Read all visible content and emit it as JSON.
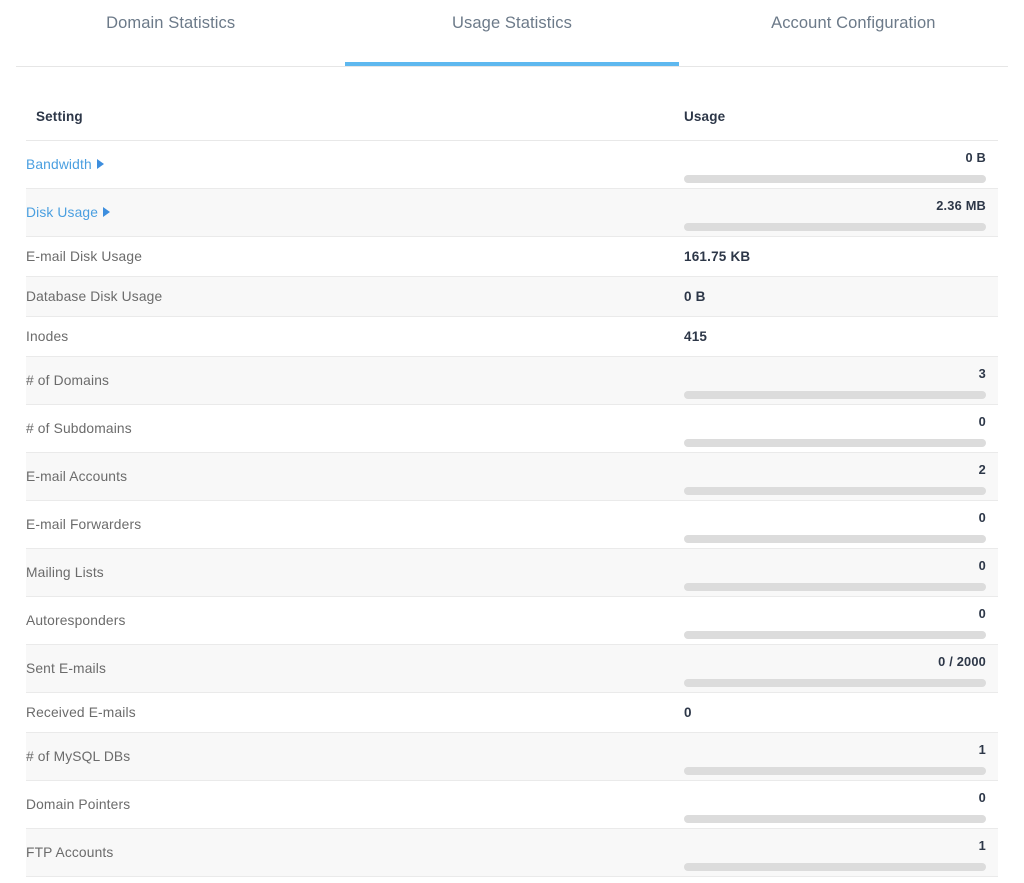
{
  "tabs": [
    {
      "label": "Domain Statistics",
      "active": false
    },
    {
      "label": "Usage Statistics",
      "active": true
    },
    {
      "label": "Account Configuration",
      "active": false
    }
  ],
  "accent_color": "#5eb8ef",
  "link_color": "#4a9fe0",
  "table": {
    "headers": {
      "setting": "Setting",
      "usage": "Usage"
    },
    "rows": [
      {
        "setting": "Bandwidth",
        "link": true,
        "caret": "triangle-right-icon",
        "usage": "0 B",
        "bar": true,
        "percent": 0
      },
      {
        "setting": "Disk Usage",
        "link": true,
        "caret": "triangle-right-icon",
        "usage": "2.36 MB",
        "bar": true,
        "percent": 0
      },
      {
        "setting": "E-mail Disk Usage",
        "link": false,
        "usage": "161.75 KB",
        "bar": false
      },
      {
        "setting": "Database Disk Usage",
        "link": false,
        "usage": "0 B",
        "bar": false
      },
      {
        "setting": "Inodes",
        "link": false,
        "usage": "415",
        "bar": false
      },
      {
        "setting": "# of Domains",
        "link": false,
        "usage": "3",
        "bar": true,
        "percent": 0
      },
      {
        "setting": "# of Subdomains",
        "link": false,
        "usage": "0",
        "bar": true,
        "percent": 0
      },
      {
        "setting": "E-mail Accounts",
        "link": false,
        "usage": "2",
        "bar": true,
        "percent": 0
      },
      {
        "setting": "E-mail Forwarders",
        "link": false,
        "usage": "0",
        "bar": true,
        "percent": 0
      },
      {
        "setting": "Mailing Lists",
        "link": false,
        "usage": "0",
        "bar": true,
        "percent": 0
      },
      {
        "setting": "Autoresponders",
        "link": false,
        "usage": "0",
        "bar": true,
        "percent": 0
      },
      {
        "setting": "Sent E-mails",
        "link": false,
        "usage": "0 / 2000",
        "bar": true,
        "percent": 0
      },
      {
        "setting": "Received E-mails",
        "link": false,
        "usage": "0",
        "bar": false
      },
      {
        "setting": "# of MySQL DBs",
        "link": false,
        "usage": "1",
        "bar": true,
        "percent": 0
      },
      {
        "setting": "Domain Pointers",
        "link": false,
        "usage": "0",
        "bar": true,
        "percent": 0
      },
      {
        "setting": "FTP Accounts",
        "link": false,
        "usage": "1",
        "bar": true,
        "percent": 0
      }
    ]
  }
}
